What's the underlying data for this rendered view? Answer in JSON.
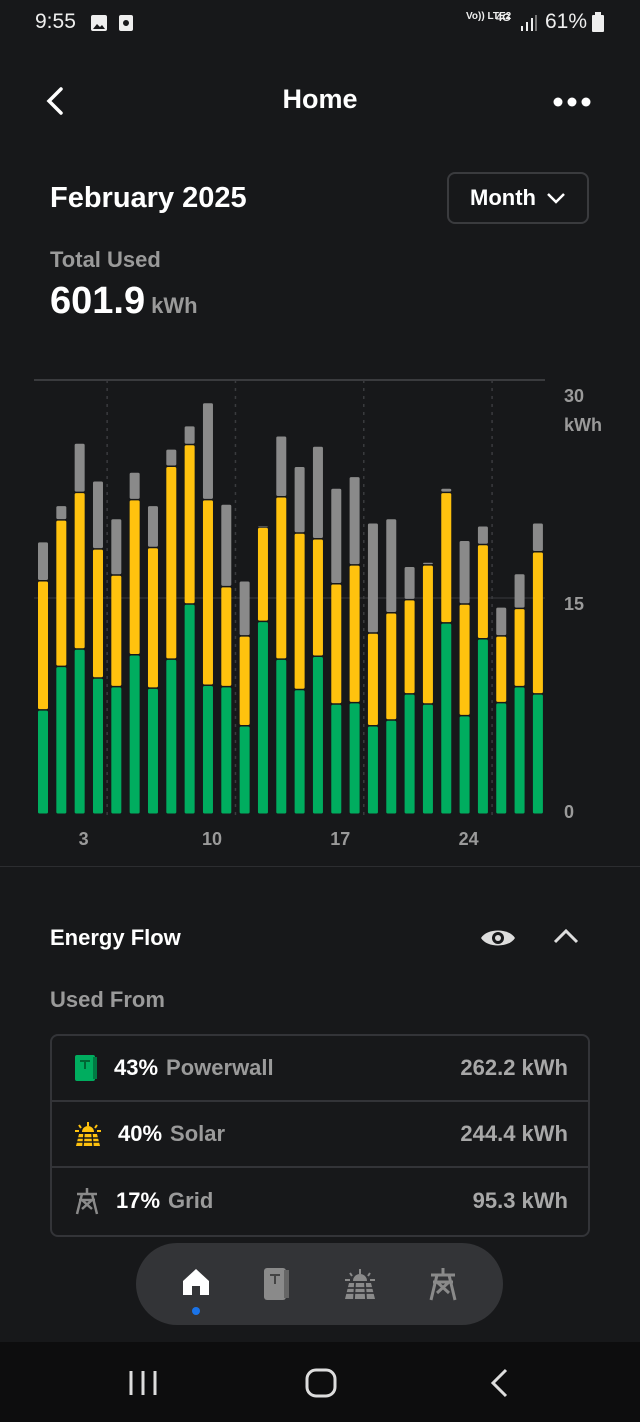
{
  "status_bar": {
    "time": "9:55",
    "battery": "61%",
    "network": "4G",
    "carrier": "Vo)) LTE2"
  },
  "header": {
    "title": "Home",
    "back_icon": "chevron-left-icon",
    "more_icon": "more-horizontal-icon"
  },
  "summary": {
    "period_title": "February 2025",
    "period_selector": "Month",
    "total_label": "Total Used",
    "total_value": "601.9",
    "total_unit": "kWh"
  },
  "colors": {
    "powerwall": "#00ad5f",
    "solar": "#ffc20e",
    "grid": "#8a8a8a",
    "accent": "#1a73e8"
  },
  "chart_data": {
    "type": "bar",
    "stacked": true,
    "ylim": [
      0,
      30
    ],
    "yticks": [
      "0",
      "15",
      "30"
    ],
    "yunit": "kWh",
    "xticks": [
      {
        "day": 3,
        "label": "3"
      },
      {
        "day": 10,
        "label": "10"
      },
      {
        "day": 17,
        "label": "17"
      },
      {
        "day": 24,
        "label": "24"
      }
    ],
    "x": [
      1,
      2,
      3,
      4,
      5,
      6,
      7,
      8,
      9,
      10,
      11,
      12,
      13,
      14,
      15,
      16,
      17,
      18,
      19,
      20,
      21,
      22,
      23,
      24,
      25,
      26,
      27,
      28
    ],
    "series": [
      {
        "key": "powerwall",
        "values": [
          7.2,
          10.2,
          11.4,
          9.4,
          8.8,
          11.0,
          8.7,
          10.7,
          14.5,
          8.9,
          8.8,
          6.1,
          13.3,
          10.7,
          8.6,
          10.9,
          7.6,
          7.7,
          6.1,
          6.5,
          8.3,
          7.6,
          13.2,
          6.8,
          12.1,
          7.7,
          8.8,
          8.3
        ]
      },
      {
        "key": "solar",
        "values": [
          8.9,
          10.1,
          10.8,
          8.9,
          7.7,
          10.7,
          9.7,
          13.3,
          11.0,
          12.8,
          6.9,
          6.2,
          6.5,
          11.2,
          10.8,
          8.1,
          8.3,
          9.5,
          6.4,
          7.4,
          6.5,
          9.6,
          9.0,
          7.7,
          6.5,
          4.6,
          5.4,
          9.8
        ]
      },
      {
        "key": "grid",
        "values": [
          2.7,
          1.0,
          3.4,
          4.7,
          3.9,
          1.9,
          2.9,
          1.2,
          1.3,
          6.7,
          5.7,
          3.8,
          0.1,
          4.2,
          4.6,
          6.4,
          6.6,
          6.1,
          7.6,
          6.5,
          2.3,
          0.2,
          0.3,
          4.4,
          1.3,
          2.0,
          2.4,
          2.0
        ]
      }
    ],
    "grid": true
  },
  "energy_flow": {
    "title": "Energy Flow",
    "subtitle": "Used From",
    "items": [
      {
        "pct": "43%",
        "name": "Powerwall",
        "value": "262.2 kWh",
        "icon": "powerwall-icon"
      },
      {
        "pct": "40%",
        "name": "Solar",
        "value": "244.4 kWh",
        "icon": "solar-panel-icon"
      },
      {
        "pct": "17%",
        "name": "Grid",
        "value": "95.3 kWh",
        "icon": "grid-tower-icon"
      }
    ]
  },
  "bottom_nav": {
    "items": [
      "home",
      "powerwall",
      "solar",
      "grid"
    ],
    "active": "home"
  }
}
